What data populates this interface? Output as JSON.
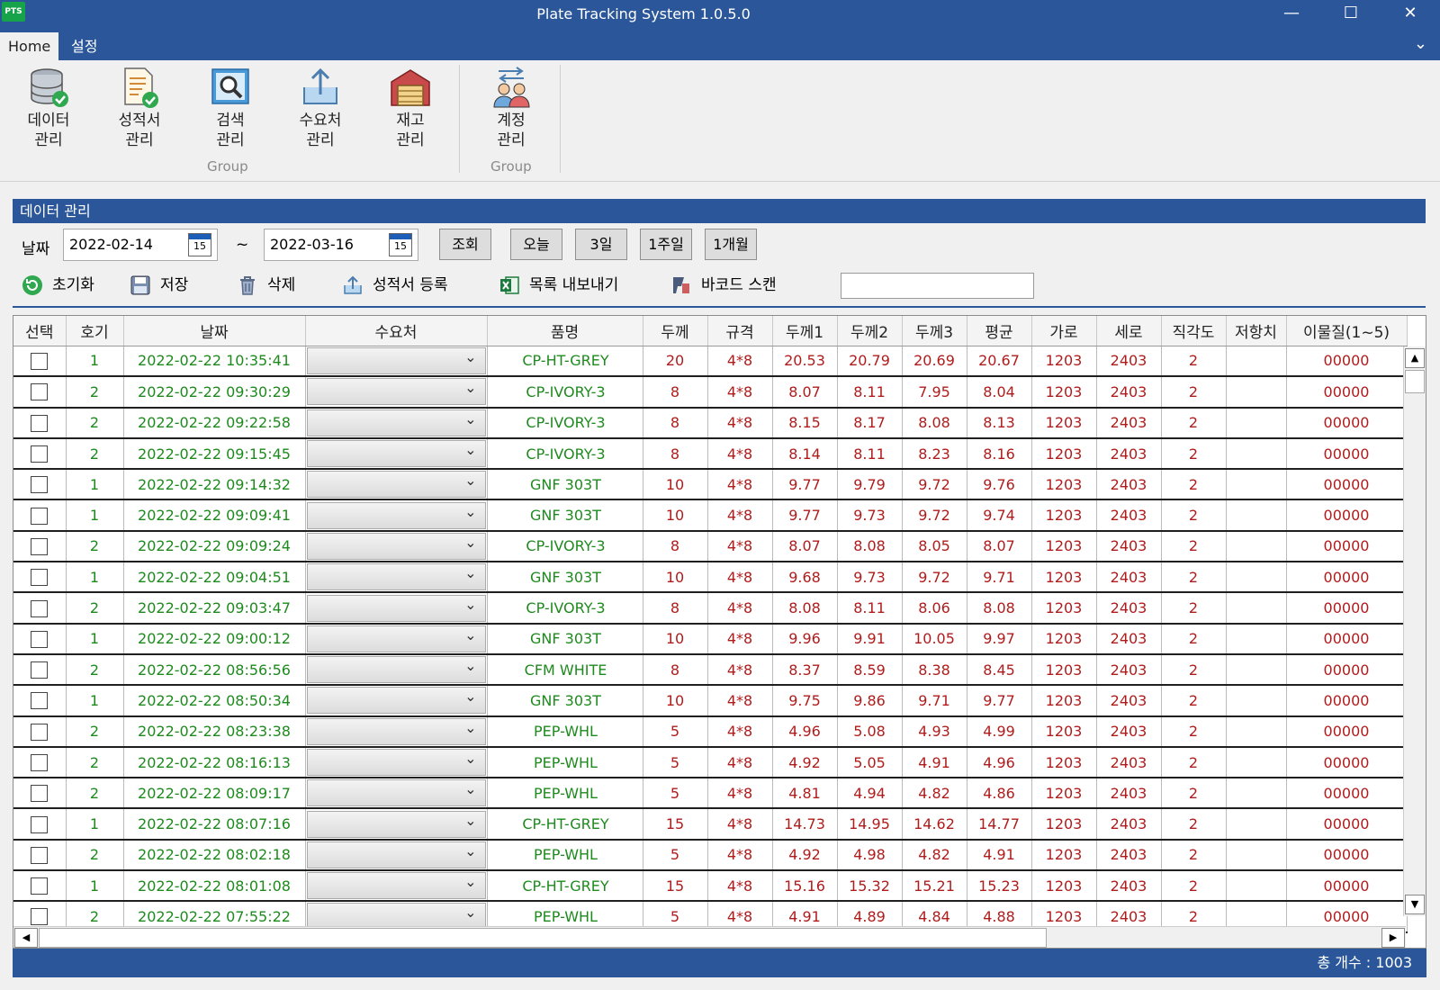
{
  "window": {
    "logo": "PTS",
    "title": "Plate Tracking System 1.0.5.0",
    "minimize": "—",
    "maximize": "☐",
    "close": "✕"
  },
  "menu": {
    "tabs": [
      "Home",
      "설정"
    ],
    "collapse": "⌄"
  },
  "ribbon": {
    "buttons": [
      {
        "line1": "데이터",
        "line2": "관리",
        "icon": "database-check-icon"
      },
      {
        "line1": "성적서",
        "line2": "관리",
        "icon": "report-check-icon"
      },
      {
        "line1": "검색",
        "line2": "관리",
        "icon": "search-icon"
      },
      {
        "line1": "수요처",
        "line2": "관리",
        "icon": "upload-icon"
      },
      {
        "line1": "재고",
        "line2": "관리",
        "icon": "warehouse-icon"
      },
      {
        "line1": "계정",
        "line2": "관리",
        "icon": "users-icon"
      }
    ],
    "group1": "Group",
    "group2": "Group"
  },
  "section_title": "데이터 관리",
  "filter": {
    "date_label": "날짜",
    "date_from": "2022-02-14",
    "tilde": "~",
    "date_to": "2022-03-16",
    "calendar_day": "15",
    "query": "조회",
    "today": "오늘",
    "three_days": "3일",
    "one_week": "1주일",
    "one_month": "1개월"
  },
  "toolbar": {
    "reset": "초기화",
    "save": "저장",
    "delete": "삭제",
    "register_report": "성적서 등록",
    "export_list": "목록 내보내기",
    "barcode_scan": "바코드 스캔",
    "barcode_value": ""
  },
  "table": {
    "headers": [
      "선택",
      "호기",
      "날짜",
      "수요처",
      "품명",
      "두께",
      "규격",
      "두께1",
      "두께2",
      "두께3",
      "평균",
      "가로",
      "세로",
      "직각도",
      "저항치",
      "이물질(1~5)"
    ],
    "rows": [
      {
        "unit": "1",
        "date": "2022-02-22 10:35:41",
        "name": "CP-HT-GREY",
        "thk": "20",
        "spec": "4*8",
        "t1": "20.53",
        "t2": "20.79",
        "t3": "20.69",
        "avg": "20.67",
        "w": "1203",
        "h": "2403",
        "sq": "2",
        "res": "",
        "fm": "00000"
      },
      {
        "unit": "2",
        "date": "2022-02-22 09:30:29",
        "name": "CP-IVORY-3",
        "thk": "8",
        "spec": "4*8",
        "t1": "8.07",
        "t2": "8.11",
        "t3": "7.95",
        "avg": "8.04",
        "w": "1203",
        "h": "2403",
        "sq": "2",
        "res": "",
        "fm": "00000"
      },
      {
        "unit": "2",
        "date": "2022-02-22 09:22:58",
        "name": "CP-IVORY-3",
        "thk": "8",
        "spec": "4*8",
        "t1": "8.15",
        "t2": "8.17",
        "t3": "8.08",
        "avg": "8.13",
        "w": "1203",
        "h": "2403",
        "sq": "2",
        "res": "",
        "fm": "00000"
      },
      {
        "unit": "2",
        "date": "2022-02-22 09:15:45",
        "name": "CP-IVORY-3",
        "thk": "8",
        "spec": "4*8",
        "t1": "8.14",
        "t2": "8.11",
        "t3": "8.23",
        "avg": "8.16",
        "w": "1203",
        "h": "2403",
        "sq": "2",
        "res": "",
        "fm": "00000"
      },
      {
        "unit": "1",
        "date": "2022-02-22 09:14:32",
        "name": "GNF 303T",
        "thk": "10",
        "spec": "4*8",
        "t1": "9.77",
        "t2": "9.79",
        "t3": "9.72",
        "avg": "9.76",
        "w": "1203",
        "h": "2403",
        "sq": "2",
        "res": "",
        "fm": "00000"
      },
      {
        "unit": "1",
        "date": "2022-02-22 09:09:41",
        "name": "GNF 303T",
        "thk": "10",
        "spec": "4*8",
        "t1": "9.77",
        "t2": "9.73",
        "t3": "9.72",
        "avg": "9.74",
        "w": "1203",
        "h": "2403",
        "sq": "2",
        "res": "",
        "fm": "00000"
      },
      {
        "unit": "2",
        "date": "2022-02-22 09:09:24",
        "name": "CP-IVORY-3",
        "thk": "8",
        "spec": "4*8",
        "t1": "8.07",
        "t2": "8.08",
        "t3": "8.05",
        "avg": "8.07",
        "w": "1203",
        "h": "2403",
        "sq": "2",
        "res": "",
        "fm": "00000"
      },
      {
        "unit": "1",
        "date": "2022-02-22 09:04:51",
        "name": "GNF 303T",
        "thk": "10",
        "spec": "4*8",
        "t1": "9.68",
        "t2": "9.73",
        "t3": "9.72",
        "avg": "9.71",
        "w": "1203",
        "h": "2403",
        "sq": "2",
        "res": "",
        "fm": "00000"
      },
      {
        "unit": "2",
        "date": "2022-02-22 09:03:47",
        "name": "CP-IVORY-3",
        "thk": "8",
        "spec": "4*8",
        "t1": "8.08",
        "t2": "8.11",
        "t3": "8.06",
        "avg": "8.08",
        "w": "1203",
        "h": "2403",
        "sq": "2",
        "res": "",
        "fm": "00000"
      },
      {
        "unit": "1",
        "date": "2022-02-22 09:00:12",
        "name": "GNF 303T",
        "thk": "10",
        "spec": "4*8",
        "t1": "9.96",
        "t2": "9.91",
        "t3": "10.05",
        "avg": "9.97",
        "w": "1203",
        "h": "2403",
        "sq": "2",
        "res": "",
        "fm": "00000"
      },
      {
        "unit": "2",
        "date": "2022-02-22 08:56:56",
        "name": "CFM WHITE",
        "thk": "8",
        "spec": "4*8",
        "t1": "8.37",
        "t2": "8.59",
        "t3": "8.38",
        "avg": "8.45",
        "w": "1203",
        "h": "2403",
        "sq": "2",
        "res": "",
        "fm": "00000"
      },
      {
        "unit": "1",
        "date": "2022-02-22 08:50:34",
        "name": "GNF 303T",
        "thk": "10",
        "spec": "4*8",
        "t1": "9.75",
        "t2": "9.86",
        "t3": "9.71",
        "avg": "9.77",
        "w": "1203",
        "h": "2403",
        "sq": "2",
        "res": "",
        "fm": "00000"
      },
      {
        "unit": "2",
        "date": "2022-02-22 08:23:38",
        "name": "PEP-WHL",
        "thk": "5",
        "spec": "4*8",
        "t1": "4.96",
        "t2": "5.08",
        "t3": "4.93",
        "avg": "4.99",
        "w": "1203",
        "h": "2403",
        "sq": "2",
        "res": "",
        "fm": "00000"
      },
      {
        "unit": "2",
        "date": "2022-02-22 08:16:13",
        "name": "PEP-WHL",
        "thk": "5",
        "spec": "4*8",
        "t1": "4.92",
        "t2": "5.05",
        "t3": "4.91",
        "avg": "4.96",
        "w": "1203",
        "h": "2403",
        "sq": "2",
        "res": "",
        "fm": "00000"
      },
      {
        "unit": "2",
        "date": "2022-02-22 08:09:17",
        "name": "PEP-WHL",
        "thk": "5",
        "spec": "4*8",
        "t1": "4.81",
        "t2": "4.94",
        "t3": "4.82",
        "avg": "4.86",
        "w": "1203",
        "h": "2403",
        "sq": "2",
        "res": "",
        "fm": "00000"
      },
      {
        "unit": "1",
        "date": "2022-02-22 08:07:16",
        "name": "CP-HT-GREY",
        "thk": "15",
        "spec": "4*8",
        "t1": "14.73",
        "t2": "14.95",
        "t3": "14.62",
        "avg": "14.77",
        "w": "1203",
        "h": "2403",
        "sq": "2",
        "res": "",
        "fm": "00000"
      },
      {
        "unit": "2",
        "date": "2022-02-22 08:02:18",
        "name": "PEP-WHL",
        "thk": "5",
        "spec": "4*8",
        "t1": "4.92",
        "t2": "4.98",
        "t3": "4.82",
        "avg": "4.91",
        "w": "1203",
        "h": "2403",
        "sq": "2",
        "res": "",
        "fm": "00000"
      },
      {
        "unit": "1",
        "date": "2022-02-22 08:01:08",
        "name": "CP-HT-GREY",
        "thk": "15",
        "spec": "4*8",
        "t1": "15.16",
        "t2": "15.32",
        "t3": "15.21",
        "avg": "15.23",
        "w": "1203",
        "h": "2403",
        "sq": "2",
        "res": "",
        "fm": "00000"
      },
      {
        "unit": "2",
        "date": "2022-02-22 07:55:22",
        "name": "PEP-WHL",
        "thk": "5",
        "spec": "4*8",
        "t1": "4.91",
        "t2": "4.89",
        "t3": "4.84",
        "avg": "4.88",
        "w": "1203",
        "h": "2403",
        "sq": "2",
        "res": "",
        "fm": "00000"
      }
    ]
  },
  "scroll": {
    "up": "▲",
    "down": "▼",
    "left": "◀",
    "right": "▶"
  },
  "status": {
    "total": "총 개수 : 1003"
  },
  "colors": {
    "accent": "#2b579a",
    "green_text": "#1e8a1e",
    "red_text": "#b01c1c"
  }
}
